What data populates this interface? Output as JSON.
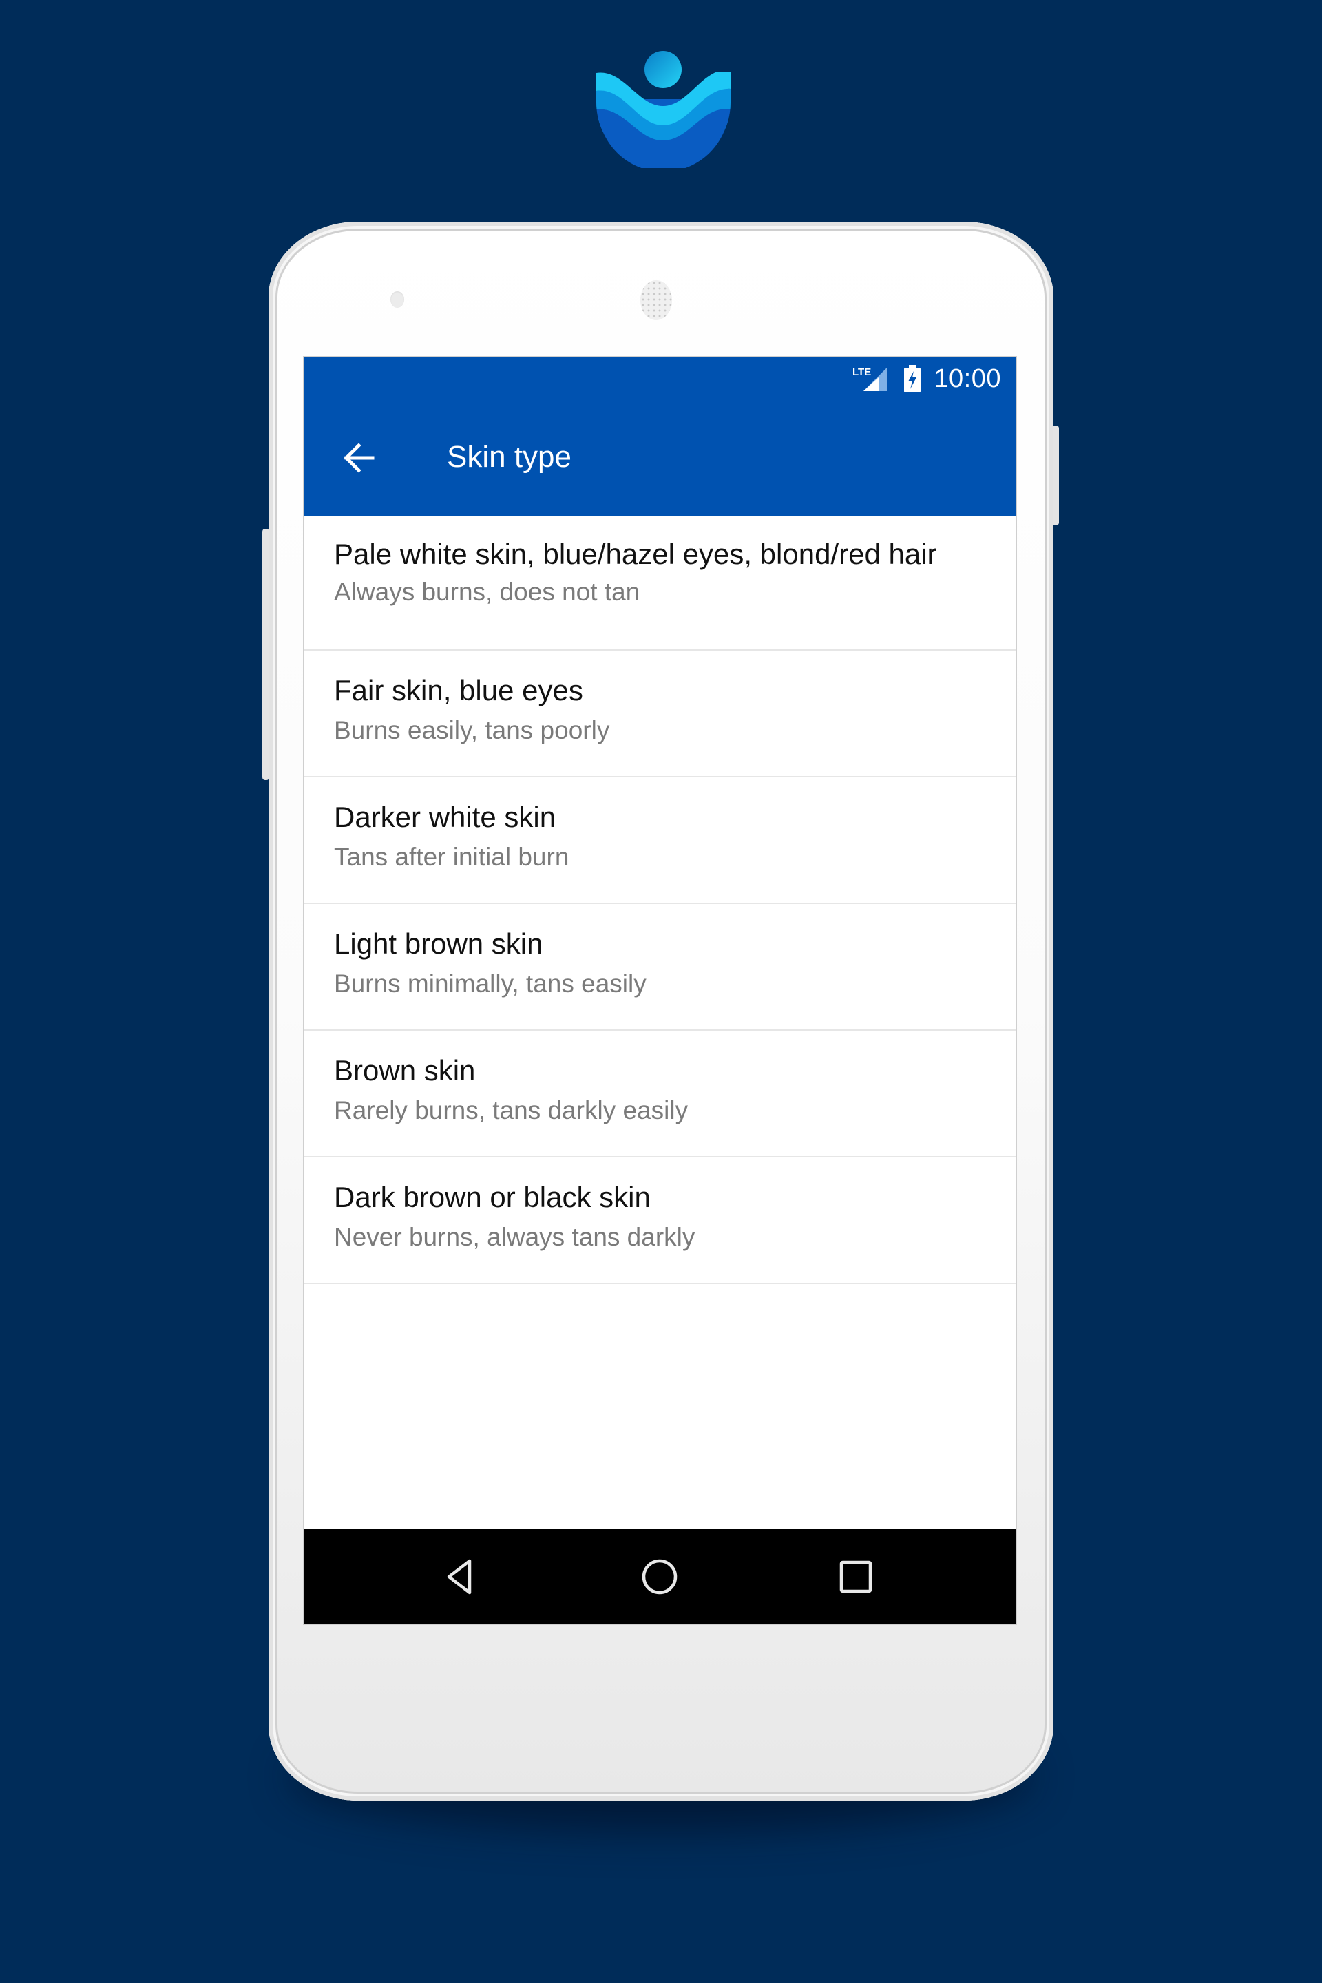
{
  "brand": {
    "logo_icon": "sun-over-waves-logo-icon",
    "colors": {
      "background": "#002c59",
      "app_bar": "#0052b0",
      "logo_light": "#1ec8f5",
      "logo_mid": "#0b95e0",
      "logo_dark": "#0a5cc2"
    }
  },
  "status_bar": {
    "network_label": "LTE",
    "signal_icon": "signal-strength-icon",
    "battery_icon": "battery-charging-icon",
    "time": "10:00"
  },
  "app_bar": {
    "back_icon": "arrow-back-icon",
    "title": "Skin type"
  },
  "skin_types": [
    {
      "title": "Pale white skin, blue/hazel eyes, blond/red hair",
      "subtitle": "Always burns, does not tan"
    },
    {
      "title": "Fair skin, blue eyes",
      "subtitle": "Burns easily, tans poorly"
    },
    {
      "title": "Darker white skin",
      "subtitle": "Tans after initial burn"
    },
    {
      "title": "Light brown skin",
      "subtitle": "Burns minimally, tans easily"
    },
    {
      "title": "Brown skin",
      "subtitle": "Rarely burns, tans darkly easily"
    },
    {
      "title": "Dark brown or black skin",
      "subtitle": "Never burns, always tans darkly"
    }
  ],
  "nav_bar": {
    "back_icon": "nav-back-triangle-icon",
    "home_icon": "nav-home-circle-icon",
    "recents_icon": "nav-recents-square-icon"
  }
}
